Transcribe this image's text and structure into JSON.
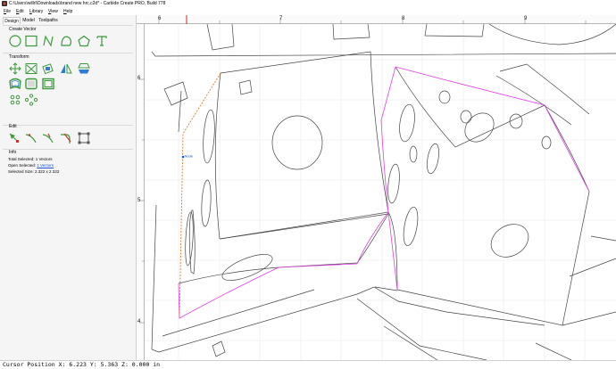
{
  "window": {
    "title": "C:\\Users\\willrl\\Downloads\\brand new hrc.c2d* - Carbide Create PRO, Build 778",
    "app_icon": "carbide-app-icon"
  },
  "menu": [
    "File",
    "Edit",
    "Library",
    "View",
    "Help"
  ],
  "tabs": [
    "Design",
    "Model",
    "Toolpaths"
  ],
  "active_tab": "Design",
  "sections": {
    "create_vector": "Create Vector",
    "transform": "Transform",
    "edit": "Edit",
    "info": "Info"
  },
  "tools": {
    "create": [
      "circle-icon",
      "rectangle-icon",
      "polyline-icon",
      "curve-icon",
      "polygon-icon",
      "text-icon"
    ],
    "transform": [
      "move-icon",
      "scale-icon",
      "rotate-icon",
      "mirror-icon",
      "align-icon",
      "offset-icon",
      "join-icon",
      "boolean-icon",
      "array-grid-icon",
      "array-circular-icon"
    ],
    "edit": [
      "node-edit-icon",
      "trim-icon",
      "split-icon",
      "fillet-icon",
      "box-select-icon"
    ]
  },
  "info": {
    "total_selected_label": "Total Selected:",
    "total_selected_value": "1 Vectors",
    "open_selected_label": "Open Selected:",
    "open_selected_value": "1 Vectors",
    "selected_size_label": "Selected Size:",
    "selected_size_value": "2.322 x 2.322"
  },
  "ruler": {
    "top_labels": [
      "6",
      "7",
      "8",
      "9"
    ],
    "left_labels": [
      "6",
      "5",
      "4"
    ]
  },
  "canvas": {
    "node_label": "Node",
    "selection_color": "#e23ee6",
    "node_color": "#e07a1f",
    "grid_color": "#e6e6e6"
  },
  "status": {
    "cursor": "Cursor Position X: 6.223 Y: 5.363 Z: 0.000 in"
  }
}
